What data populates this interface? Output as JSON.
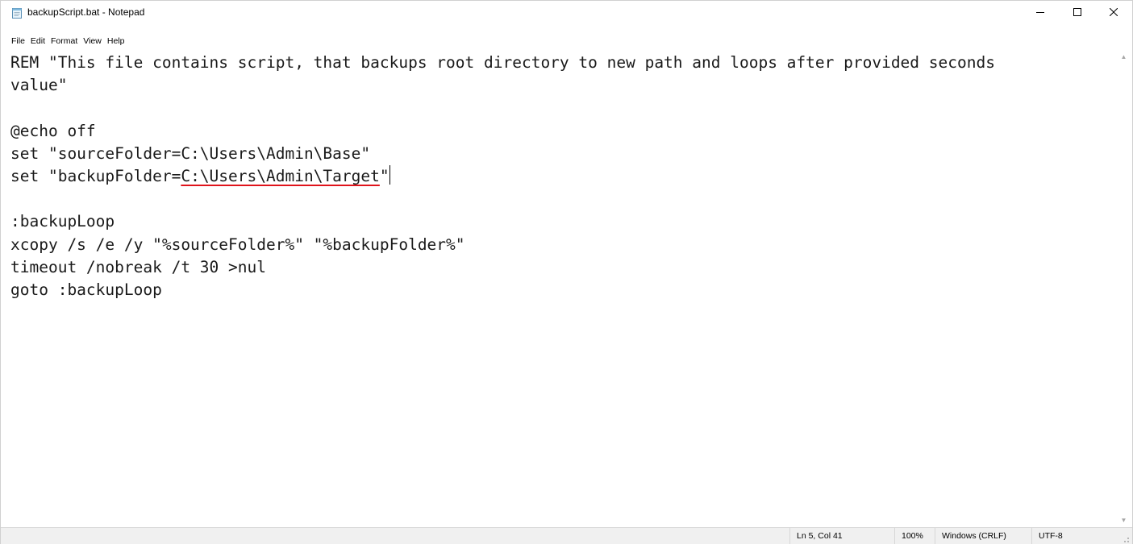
{
  "window": {
    "title": "backupScript.bat - Notepad",
    "icon": "notepad-icon",
    "controls": {
      "minimize": "minimize-icon",
      "maximize": "maximize-icon",
      "close": "close-icon"
    }
  },
  "menu": {
    "file": "File",
    "edit": "Edit",
    "format": "Format",
    "view": "View",
    "help": "Help"
  },
  "editor": {
    "lines": [
      "REM \"This file contains script, that backups root directory to new path and loops after provided seconds",
      "value\"",
      "",
      "@echo off",
      "set \"sourceFolder=C:\\Users\\Admin\\Base\"",
      "",
      "",
      ":backupLoop",
      "xcopy /s /e /y \"%sourceFolder%\" \"%backupFolder%\"",
      "timeout /nobreak /t 30 >nul",
      "goto :backupLoop"
    ],
    "line6": {
      "prefix": "set \"backupFolder=",
      "misspelled": "C:\\Users\\Admin\\Target",
      "suffix": "\""
    },
    "spellcheck_color": "#e0131b"
  },
  "statusbar": {
    "position": "Ln 5, Col 41",
    "zoom": "100%",
    "line_ending": "Windows (CRLF)",
    "encoding": "UTF-8"
  }
}
